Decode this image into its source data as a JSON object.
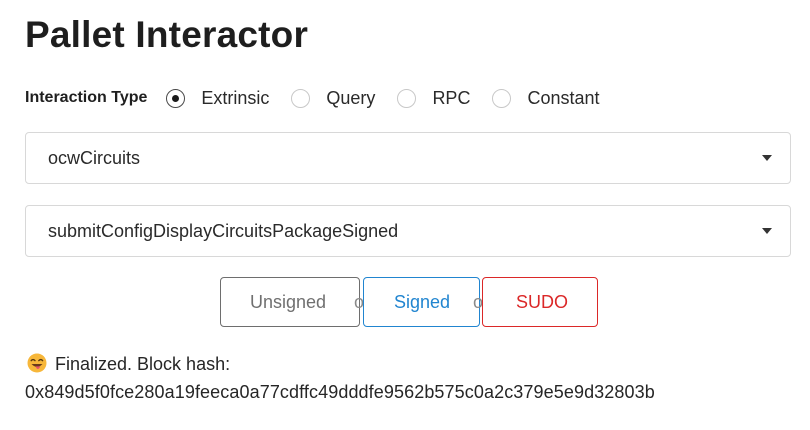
{
  "page": {
    "title": "Pallet Interactor"
  },
  "interaction_type": {
    "label": "Interaction Type",
    "options": [
      "Extrinsic",
      "Query",
      "RPC",
      "Constant"
    ],
    "selected": "Extrinsic"
  },
  "pallet_select": {
    "value": "ocwCircuits"
  },
  "callable_select": {
    "value": "submitConfigDisplayCircuitsPackageSigned"
  },
  "tx_buttons": {
    "unsigned": "Unsigned",
    "signed": "Signed",
    "sudo": "SUDO",
    "separator": "or"
  },
  "status": {
    "icon": "grinning-face-with-tongue-icon",
    "text": "Finalized. Block hash:",
    "hash": "0x849d5f0fce280a19feeca0a77cdffc49dddfe9562b575c0a2c379e5e9d32803b"
  },
  "colors": {
    "signed": "#2185d0",
    "sudo": "#db2828",
    "unsigned_border": "#6e6e6e"
  }
}
